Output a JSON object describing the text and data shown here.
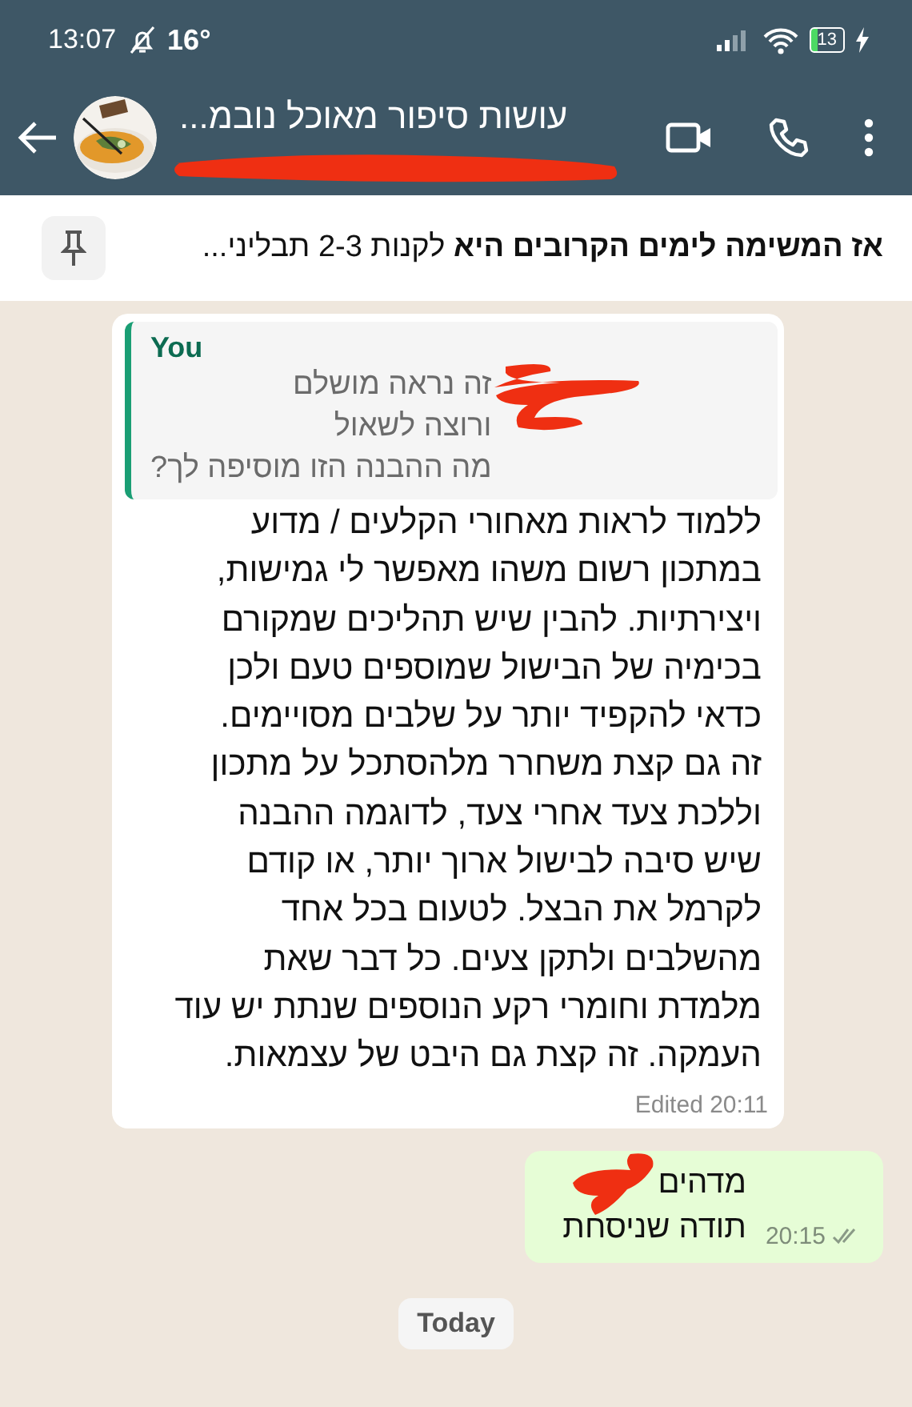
{
  "status_bar": {
    "time": "13:07",
    "temperature": "16°",
    "battery": "13"
  },
  "header": {
    "title": "עושות סיפור מאוכל נובמ...",
    "subtitle_redacted": true
  },
  "pinned": {
    "text": "**אז המשימה לימים הקרובים היא** לקנות 2-3 תבליני..."
  },
  "messages": [
    {
      "kind": "incoming",
      "quote": {
        "author": "You",
        "lines": [
          "זה נראה מושלם",
          "ורוצה לשאול",
          "מה ההבנה הזו מוסיפה לך?"
        ],
        "redacted": true
      },
      "lines": [
        "ללמוד לראות מאחורי הקלעים / מדוע",
        "במתכון רשום משהו מאפשר לי גמישות,",
        "ויצירתיות. להבין שיש תהליכים שמקורם",
        "בכימיה של הבישול שמוספים טעם ולכן",
        "כדאי להקפיד יותר על שלבים מסויימים.",
        "זה גם קצת משחרר מלהסתכל על מתכון",
        "וללכת צעד אחרי צעד, לדוגמה ההבנה",
        "שיש סיבה לבישול ארוך יותר, או קודם",
        "לקרמל את הבצל. לטעום בכל אחד",
        "מהשלבים ולתקן צעים. כל דבר שאת",
        "מלמדת וחומרי רקע הנוספים שנתת יש עוד",
        "העמקה. זה קצת גם היבט של עצמאות."
      ],
      "meta": "Edited 20:11"
    },
    {
      "kind": "outgoing",
      "lines": [
        "מדהים",
        "תודה שניסחת"
      ],
      "meta": "20:15",
      "read": true,
      "redacted": true
    }
  ],
  "date_chip": "Today"
}
